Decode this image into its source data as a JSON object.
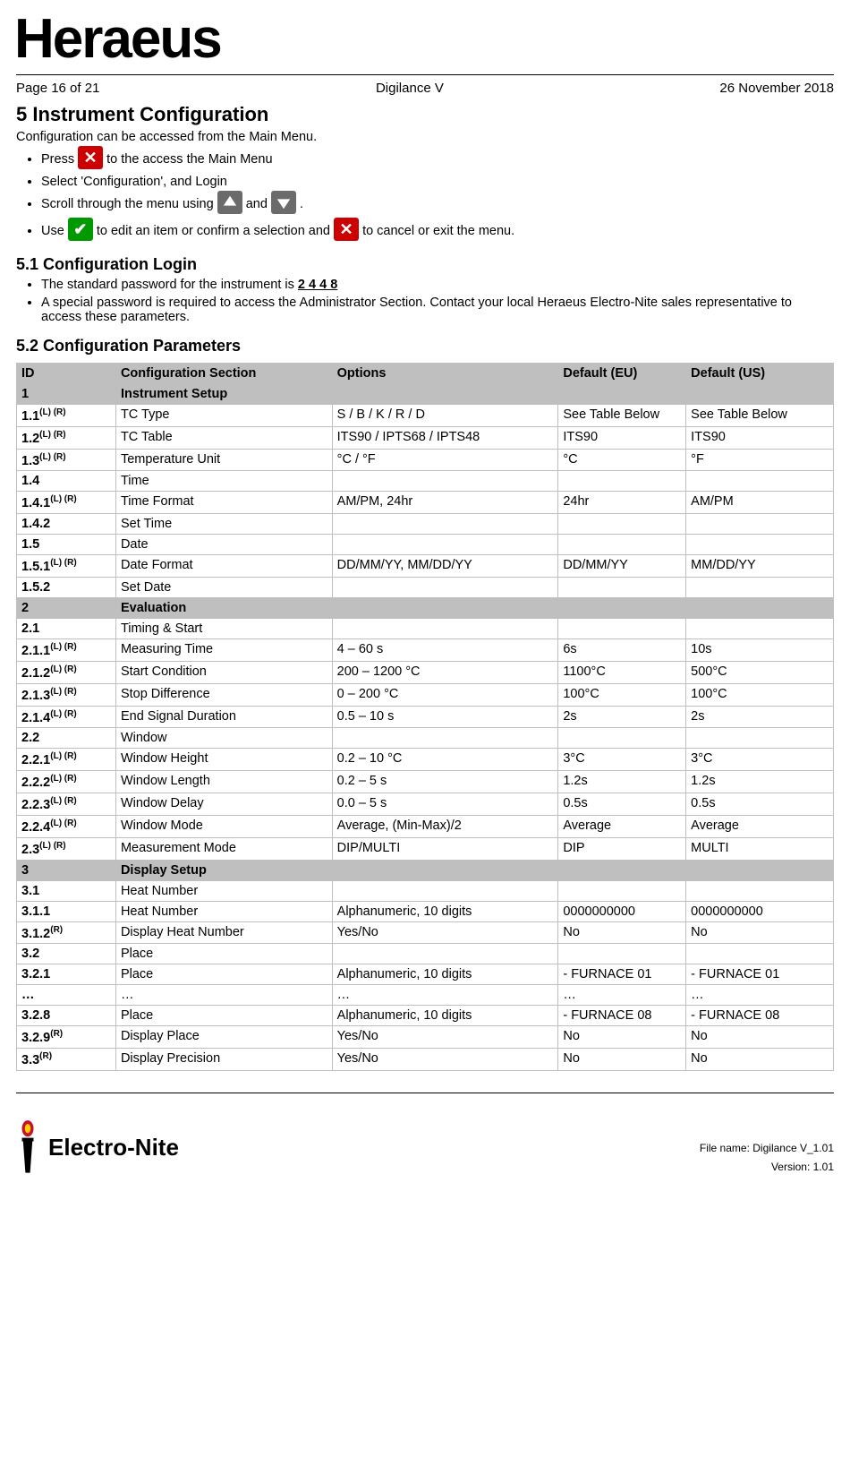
{
  "logo_top": "Heraeus",
  "header": {
    "page": "Page 16 of 21",
    "title": "Digilance V",
    "date": "26 November 2018"
  },
  "h1": "5  Instrument Configuration",
  "intro": "Configuration can be accessed from the Main Menu.",
  "b1a": "Press ",
  "b1b": " to the access the Main Menu",
  "b2": "Select 'Configuration', and Login",
  "b3a": "Scroll through the menu using ",
  "b3b": " and ",
  "b3c": ".",
  "b4a": "Use ",
  "b4b": " to edit an item or confirm a selection and ",
  "b4c": " to cancel or exit the menu.",
  "h2a": "5.1   Configuration Login",
  "login1a": "The standard password for the instrument is ",
  "login1b": "2 4 4 8",
  "login2": "A special password is required to access the Administrator Section. Contact your local Heraeus Electro-Nite sales representative to access these parameters.",
  "h2b": "5.2   Configuration Parameters",
  "thead": {
    "id": "ID",
    "section": "Configuration Section",
    "options": "Options",
    "eu": "Default (EU)",
    "us": "Default (US)"
  },
  "rows": [
    {
      "shade": true,
      "id": "1",
      "section": "Instrument Setup",
      "options": "",
      "eu": "",
      "us": ""
    },
    {
      "id": "1.1",
      "sup": "(L) (R)",
      "section": "TC Type",
      "options": "S / B / K / R / D",
      "eu": "See Table Below",
      "us": "See Table Below"
    },
    {
      "id": "1.2",
      "sup": "(L) (R)",
      "section": "TC Table",
      "options": "ITS90 / IPTS68 / IPTS48",
      "eu": "ITS90",
      "us": "ITS90"
    },
    {
      "id": "1.3",
      "sup": "(L) (R)",
      "section": "Temperature Unit",
      "options": "°C / °F",
      "eu": "°C",
      "us": "°F"
    },
    {
      "id": "1.4",
      "section": "Time",
      "options": "",
      "eu": "",
      "us": ""
    },
    {
      "id": "1.4.1",
      "sup": "(L) (R)",
      "section": "Time Format",
      "options": "AM/PM, 24hr",
      "eu": "24hr",
      "us": "AM/PM"
    },
    {
      "id": "1.4.2",
      "section": "Set Time",
      "options": "",
      "eu": "",
      "us": ""
    },
    {
      "id": "1.5",
      "section": "Date",
      "options": "",
      "eu": "",
      "us": ""
    },
    {
      "id": "1.5.1",
      "sup": "(L) (R)",
      "section": "Date Format",
      "options": "DD/MM/YY, MM/DD/YY",
      "eu": "DD/MM/YY",
      "us": "MM/DD/YY"
    },
    {
      "id": "1.5.2",
      "section": "Set Date",
      "options": "",
      "eu": "",
      "us": ""
    },
    {
      "shade": true,
      "id": "2",
      "section": "Evaluation",
      "options": "",
      "eu": "",
      "us": ""
    },
    {
      "id": "2.1",
      "section": "Timing & Start",
      "options": "",
      "eu": "",
      "us": ""
    },
    {
      "id": "2.1.1",
      "sup": "(L) (R)",
      "section": "Measuring Time",
      "options": "4 – 60 s",
      "eu": "6s",
      "us": "10s"
    },
    {
      "id": "2.1.2",
      "sup": "(L) (R)",
      "section": "Start Condition",
      "options": "200 – 1200 °C",
      "eu": "1100°C",
      "us": "500°C"
    },
    {
      "id": "2.1.3",
      "sup": "(L) (R)",
      "section": "Stop Difference",
      "options": "0 – 200 °C",
      "eu": "100°C",
      "us": "100°C"
    },
    {
      "id": "2.1.4",
      "sup": "(L) (R)",
      "section": "End Signal Duration",
      "options": "0.5 – 10 s",
      "eu": "2s",
      "us": "2s"
    },
    {
      "id": "2.2",
      "section": "Window",
      "options": "",
      "eu": "",
      "us": ""
    },
    {
      "id": "2.2.1",
      "sup": "(L) (R)",
      "section": "Window Height",
      "options": "0.2 – 10 °C",
      "eu": "3°C",
      "us": "3°C"
    },
    {
      "id": "2.2.2",
      "sup": "(L) (R)",
      "section": "Window Length",
      "options": "0.2 – 5 s",
      "eu": "1.2s",
      "us": "1.2s"
    },
    {
      "id": "2.2.3",
      "sup": "(L) (R)",
      "section": "Window Delay",
      "options": "0.0 – 5 s",
      "eu": "0.5s",
      "us": "0.5s"
    },
    {
      "id": "2.2.4",
      "sup": "(L) (R)",
      "section": "Window Mode",
      "options": "Average, (Min-Max)/2",
      "eu": "Average",
      "us": "Average"
    },
    {
      "id": "2.3",
      "sup": "(L) (R)",
      "section": "Measurement Mode",
      "options": "DIP/MULTI",
      "eu": "DIP",
      "us": "MULTI"
    },
    {
      "shade": true,
      "id": "3",
      "section": "Display Setup",
      "options": "",
      "eu": "",
      "us": ""
    },
    {
      "id": "3.1",
      "section": "Heat Number",
      "options": "",
      "eu": "",
      "us": ""
    },
    {
      "id": "3.1.1",
      "section": "Heat Number",
      "options": "Alphanumeric, 10 digits",
      "eu": "0000000000",
      "us": "0000000000"
    },
    {
      "id": "3.1.2",
      "sup": "(R)",
      "section": "Display Heat Number",
      "options": "Yes/No",
      "eu": "No",
      "us": "No"
    },
    {
      "id": "3.2",
      "section": "Place",
      "options": "",
      "eu": "",
      "us": ""
    },
    {
      "id": "3.2.1",
      "section": "Place",
      "options": "Alphanumeric, 10 digits",
      "eu": "- FURNACE 01",
      "us": "- FURNACE 01"
    },
    {
      "id": "…",
      "section": "…",
      "options": "…",
      "eu": "…",
      "us": "…"
    },
    {
      "id": "3.2.8",
      "section": "Place",
      "options": "Alphanumeric, 10 digits",
      "eu": "- FURNACE 08",
      "us": "- FURNACE 08"
    },
    {
      "id": "3.2.9",
      "sup": "(R)",
      "section": "Display Place",
      "options": "Yes/No",
      "eu": "No",
      "us": "No"
    },
    {
      "id": "3.3",
      "sup": "(R)",
      "section": "Display Precision",
      "options": "Yes/No",
      "eu": "No",
      "us": "No"
    }
  ],
  "footer": {
    "logo_text": "Electro-Nite",
    "filename_label": "File name:",
    "filename_value": "Digilance V_1.01",
    "version": "Version: 1.01"
  }
}
